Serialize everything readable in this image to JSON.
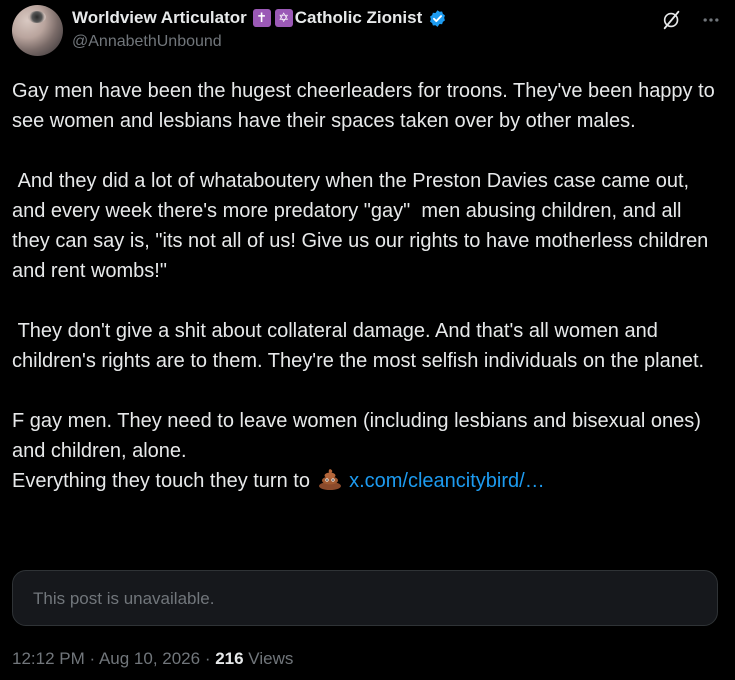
{
  "author": {
    "display_name": "Worldview Articulator",
    "name_suffix": "Catholic Zionist",
    "badge_cross": "✝",
    "badge_star": "✡",
    "handle": "@AnnabethUnbound",
    "verified_color": "#1d9bf0"
  },
  "post": {
    "text": "Gay men have been the hugest cheerleaders for troons. They've been happy to see women and lesbians have their spaces taken over by other males.\n\n And they did a lot of whataboutery when the Preston Davies case came out, and every week there's more predatory \"gay\"  men abusing children, and all they can say is, \"its not all of us! Give us our rights to have motherless children and rent wombs!\"\n\n They don't give a shit about collateral damage. And that's all women and children's rights are to them. They're the most selfish individuals on the planet.\n\nF gay men. They need to leave women (including lesbians and bisexual ones) and children, alone.\nEverything they touch they turn to ",
    "emoji": "pile-of-poo",
    "link": "x.com/cleancitybird/…"
  },
  "quoted_post": {
    "unavailable_text": "This post is unavailable."
  },
  "meta": {
    "time": "12:12 PM",
    "separator": " · ",
    "date": "Aug 10, 2026",
    "views_count": "216",
    "views_label": " Views"
  },
  "colors": {
    "background": "#000000",
    "text": "#e7e9ea",
    "muted": "#71767b",
    "link": "#1d9bf0",
    "badge": "#9b59b6"
  }
}
